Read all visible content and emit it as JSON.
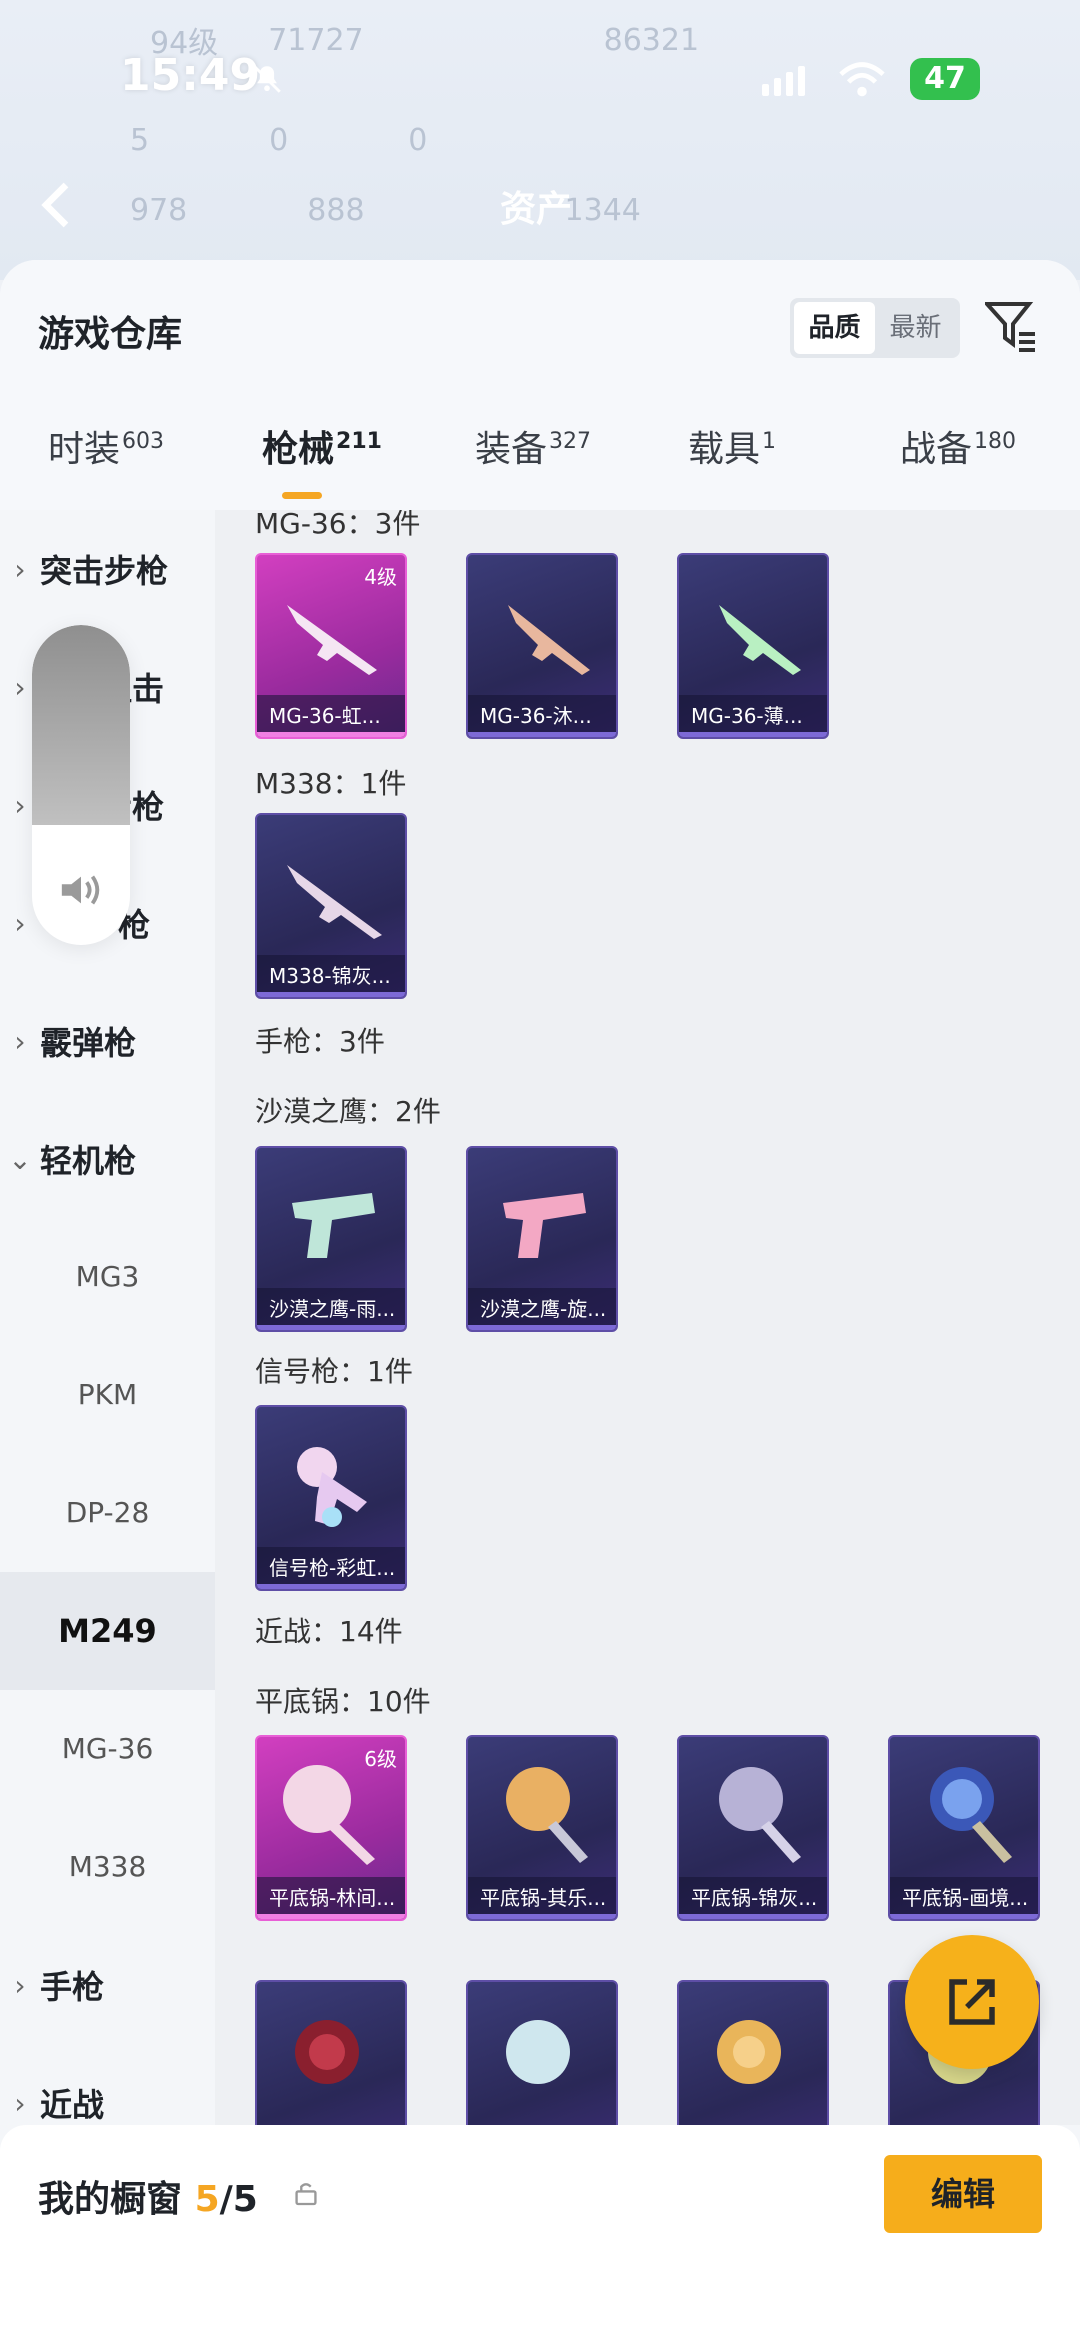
{
  "status": {
    "time": "15:49",
    "battery": "47"
  },
  "backdrop": {
    "row1": [
      "94级",
      "71727",
      "86321"
    ],
    "row2": [
      "5",
      "0",
      "0"
    ],
    "row3": [
      "978",
      "888",
      "1344"
    ],
    "asset_label": "资产"
  },
  "header": {
    "title": "游戏仓库",
    "sort_quality": "品质",
    "sort_newest": "最新"
  },
  "tabs": [
    {
      "label": "时装",
      "count": "603"
    },
    {
      "label": "枪械",
      "count": "211"
    },
    {
      "label": "装备",
      "count": "327"
    },
    {
      "label": "载具",
      "count": "1"
    },
    {
      "label": "战备",
      "count": "180"
    }
  ],
  "nav": {
    "groups": [
      {
        "label": "突击步枪"
      },
      {
        "label": "狙击"
      },
      {
        "label": "步枪"
      },
      {
        "label": "枪"
      },
      {
        "label": "霰弹枪"
      },
      {
        "label": "轻机枪"
      }
    ],
    "sub": [
      "MG3",
      "PKM",
      "DP-28",
      "M249",
      "MG-36",
      "M338"
    ],
    "groups_after": [
      {
        "label": "手枪"
      },
      {
        "label": "近战"
      }
    ]
  },
  "content": {
    "sections": [
      {
        "label": "MG-36：3件"
      },
      {
        "label": "M338：1件"
      },
      {
        "label": "手枪：3件"
      },
      {
        "label": "沙漠之鹰：2件"
      },
      {
        "label": "信号枪：1件"
      },
      {
        "label": "近战：14件"
      },
      {
        "label": "平底锅：10件"
      }
    ],
    "cards": [
      {
        "name": "MG-36-虹...",
        "level": "4级"
      },
      {
        "name": "MG-36-沐..."
      },
      {
        "name": "MG-36-薄..."
      },
      {
        "name": "M338-锦灰..."
      },
      {
        "name": "沙漠之鹰-雨..."
      },
      {
        "name": "沙漠之鹰-旋..."
      },
      {
        "name": "信号枪-彩虹..."
      },
      {
        "name": "平底锅-林间...",
        "level": "6级"
      },
      {
        "name": "平底锅-其乐..."
      },
      {
        "name": "平底锅-锦灰..."
      },
      {
        "name": "平底锅-画境..."
      }
    ]
  },
  "bottom": {
    "title": "我的橱窗",
    "count": "5",
    "total": "/5",
    "edit_label": "编辑"
  },
  "colors": {
    "accent": "#f6ad1b",
    "purple_card": "#2a2857",
    "pink_card": "#d23fc0"
  },
  "icons": [
    "bell-off-icon",
    "wifi-icon",
    "back-icon",
    "filter-icon",
    "speaker-icon",
    "share-icon",
    "lock-icon"
  ]
}
